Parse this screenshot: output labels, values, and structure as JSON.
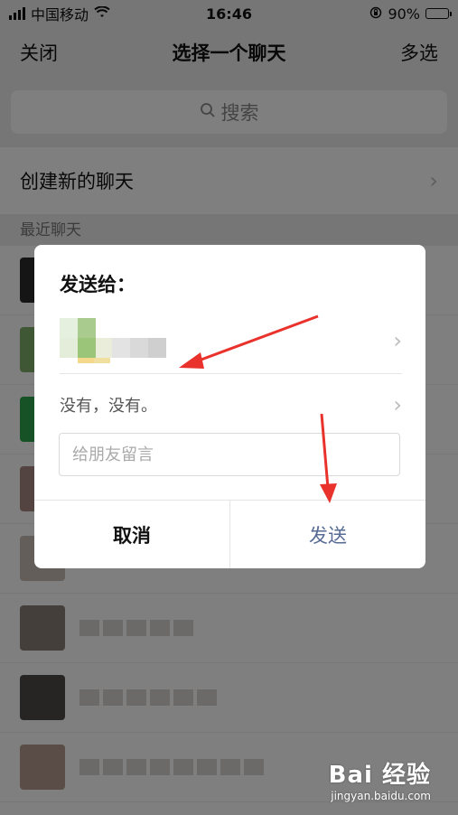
{
  "status_bar": {
    "carrier": "中国移动",
    "time": "16:46",
    "battery_percent": "90%",
    "battery_level": 0.9
  },
  "nav": {
    "close_label": "关闭",
    "title": "选择一个聊天",
    "multi_select_label": "多选"
  },
  "search": {
    "placeholder": "搜索"
  },
  "create_new_chat": {
    "label": "创建新的聊天"
  },
  "recent_section": {
    "label": "最近聊天"
  },
  "dialog": {
    "title": "发送给：",
    "preview_text": "没有，没有。",
    "message_placeholder": "给朋友留言",
    "cancel_label": "取消",
    "send_label": "发送"
  },
  "colors": {
    "send_text": "#576b95",
    "annotation_arrow": "#e8322b"
  },
  "watermark": {
    "brand": "Bai 经验",
    "url": "jingyan.baidu.com"
  }
}
